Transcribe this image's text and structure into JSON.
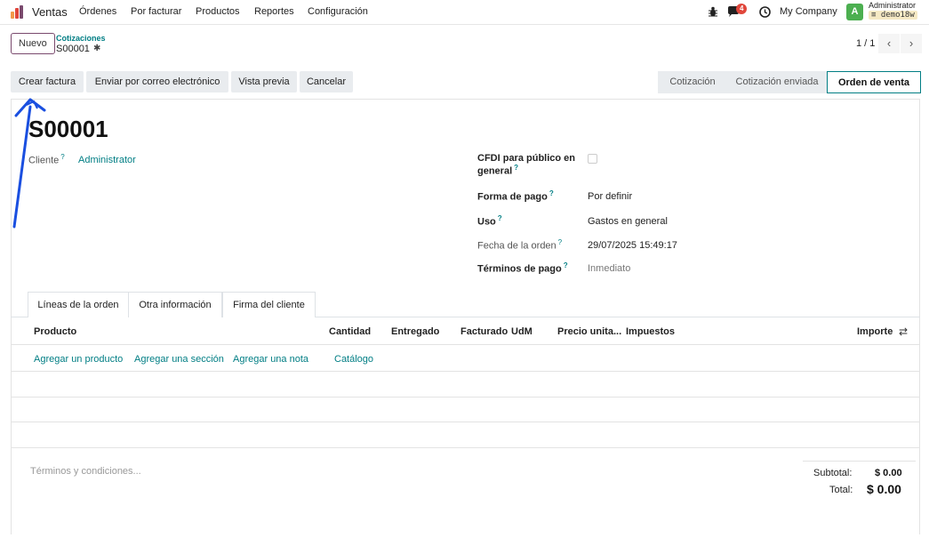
{
  "navbar": {
    "app_name": "Ventas",
    "menus": [
      "Órdenes",
      "Por facturar",
      "Productos",
      "Reportes",
      "Configuración"
    ],
    "message_count": "4",
    "company": "My Company",
    "user_initial": "A",
    "user_name": "Administrator",
    "database": "demo18w",
    "icons": [
      "bug-icon",
      "chat-icon",
      "clock-icon"
    ]
  },
  "control": {
    "new_label": "Nuevo",
    "breadcrumb_parent": "Cotizaciones",
    "breadcrumb_current": "S00001",
    "pager": "1 / 1"
  },
  "actions": {
    "create_invoice": "Crear factura",
    "send_email": "Enviar por correo electrónico",
    "preview": "Vista previa",
    "cancel": "Cancelar"
  },
  "status": {
    "steps": [
      "Cotización",
      "Cotización enviada",
      "Orden de venta"
    ],
    "active": "Orden de venta"
  },
  "record": {
    "name": "S00001",
    "customer_label": "Cliente",
    "customer_value": "Administrator",
    "cfdi_label_line1": "CFDI para público en",
    "cfdi_label_line2": "general",
    "payment_form_label": "Forma de pago",
    "payment_form_value": "Por definir",
    "usage_label": "Uso",
    "usage_value": "Gastos en general",
    "order_date_label": "Fecha de la orden",
    "order_date_value": "29/07/2025 15:49:17",
    "payment_terms_label": "Términos de pago",
    "payment_terms_value": "Inmediato"
  },
  "tabs": [
    "Líneas de la orden",
    "Otra información",
    "Firma del cliente"
  ],
  "table": {
    "headers": {
      "product": "Producto",
      "quantity": "Cantidad",
      "delivered": "Entregado",
      "invoiced": "Facturado",
      "uom": "UdM",
      "unit_price": "Precio unita...",
      "taxes": "Impuestos",
      "amount": "Importe"
    },
    "add_product": "Agregar un producto",
    "add_section": "Agregar una sección",
    "add_note": "Agregar una nota",
    "catalog": "Catálogo"
  },
  "footer": {
    "terms_placeholder": "Términos y condiciones...",
    "subtotal_label": "Subtotal:",
    "subtotal_value": "$ 0.00",
    "total_label": "Total:",
    "total_value": "$ 0.00"
  },
  "colors": {
    "brand": "#7a4a6e",
    "link": "#017e84",
    "annotation_arrow": "#1a4fe0"
  }
}
